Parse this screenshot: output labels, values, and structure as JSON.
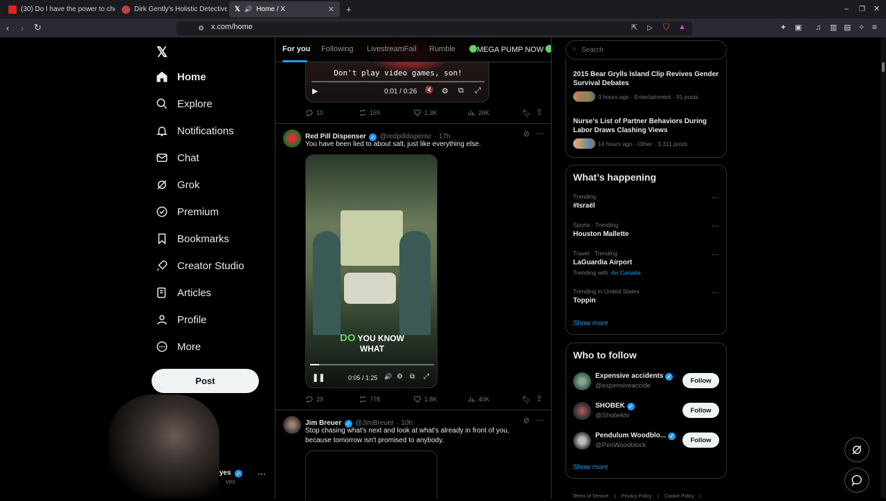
{
  "browser": {
    "tabs": [
      {
        "title": "(30) Do I have the power to cho",
        "active": false,
        "icon": "youtube-icon"
      },
      {
        "title": "Dirk Gently's Holistic Detective A",
        "active": false,
        "icon": "site-icon"
      },
      {
        "title": "Home / X",
        "active": true,
        "icon": "x-logo-icon"
      }
    ],
    "url": "x.com/home"
  },
  "nav": {
    "items": [
      {
        "label": "Home",
        "icon": "home-icon"
      },
      {
        "label": "Explore",
        "icon": "search-icon"
      },
      {
        "label": "Notifications",
        "icon": "bell-icon"
      },
      {
        "label": "Chat",
        "icon": "mail-icon"
      },
      {
        "label": "Grok",
        "icon": "grok-icon"
      },
      {
        "label": "Premium",
        "icon": "verified-icon"
      },
      {
        "label": "Bookmarks",
        "icon": "bookmark-icon"
      },
      {
        "label": "Creator Studio",
        "icon": "rocket-icon"
      },
      {
        "label": "Articles",
        "icon": "article-icon"
      },
      {
        "label": "Profile",
        "icon": "user-icon"
      },
      {
        "label": "More",
        "icon": "more-circle-icon"
      }
    ],
    "post_label": "Post",
    "account_name_fragment": "yes",
    "account_handle_fragment": "ves"
  },
  "feed": {
    "tabs": [
      "For you",
      "Following",
      "LivestreamFail",
      "Rumble",
      "MEGA PUMP NOW"
    ],
    "tweet1": {
      "caption": "Don't play video games, son!",
      "time": "0:01 / 0:26",
      "stats": {
        "replies": "10",
        "reposts": "159",
        "likes": "1.3K",
        "views": "26K"
      }
    },
    "tweet2": {
      "name": "Red Pill Dispenser",
      "handle": "@redpilldispensr",
      "age": "· 17h",
      "text": "You have been lied to about salt, just like everything else.",
      "video_caption_1": "DO",
      "video_caption_2": "YOU KNOW",
      "video_caption_3": "WHAT",
      "video_time": "0:05 / 1:25",
      "video_progress": 0.07,
      "stats": {
        "replies": "29",
        "reposts": "778",
        "likes": "1.8K",
        "views": "40K"
      }
    },
    "tweet3": {
      "name": "Jim Breuer",
      "handle": "@JimBreuer",
      "age": "· 10h",
      "text_line1": "Stop chasing what's next and look at what's already in front of you,",
      "text_line2": "because tomorrow isn't promised to anybody."
    }
  },
  "sidebar": {
    "search_placeholder": "Search",
    "news": [
      {
        "title_l1": "2015 Bear Grylls Island Clip Revives Gender",
        "title_l2": "Survival Debates",
        "meta": "3 hours ago · Entertainment · 91 posts"
      },
      {
        "title_l1": "Nurse's List of Partner Behaviors During",
        "title_l2": "Labor Draws Clashing Views",
        "meta": "14 hours ago · Other · 3,311 posts"
      }
    ],
    "whats_happening": {
      "title": "What’s happening",
      "trends": [
        {
          "meta": "Trending",
          "name": "#Israël",
          "extra": ""
        },
        {
          "meta": "Sports · Trending",
          "name": "Houston Mallette",
          "extra": ""
        },
        {
          "meta": "Travel · Trending",
          "name": "LaGuardia Airport",
          "extra_prefix": "Trending with",
          "extra": "Air Canada"
        },
        {
          "meta": "Trending in United States",
          "name": "Toppin",
          "extra": ""
        }
      ],
      "show_more": "Show more"
    },
    "who_to_follow": {
      "title": "Who to follow",
      "accounts": [
        {
          "name": "Expensive accidents",
          "handle": "@expensiveaccide",
          "button": "Follow"
        },
        {
          "name": "SHOBEK",
          "handle": "@Shobektv",
          "button": "Follow"
        },
        {
          "name": "Pendulum Woodblo...",
          "handle": "@PenWoodblock",
          "button": "Follow"
        }
      ],
      "show_more": "Show more"
    },
    "footer": [
      "Terms of Service",
      "|",
      "Privacy Policy",
      "|",
      "Cookie Policy",
      "|"
    ]
  }
}
